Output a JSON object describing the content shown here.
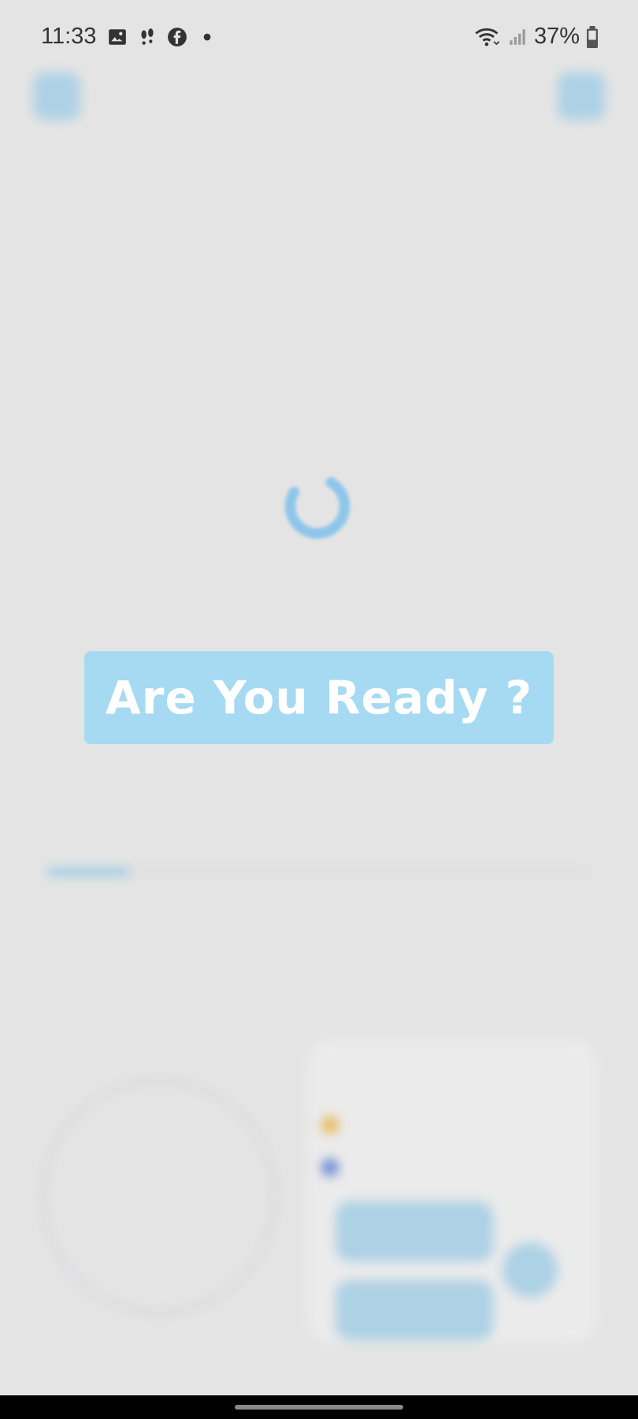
{
  "status_bar": {
    "time": "11:33",
    "battery_percent": "37%",
    "left_icons": [
      "gallery-icon",
      "steps-icon",
      "facebook-icon",
      "dot-icon"
    ],
    "right_icons": [
      "wifi-icon",
      "signal-icon",
      "battery-icon"
    ]
  },
  "overlay": {
    "ready_label": "Are You Ready ?"
  },
  "background": {
    "progress": 0.15,
    "accent_color": "#a6daf2"
  }
}
